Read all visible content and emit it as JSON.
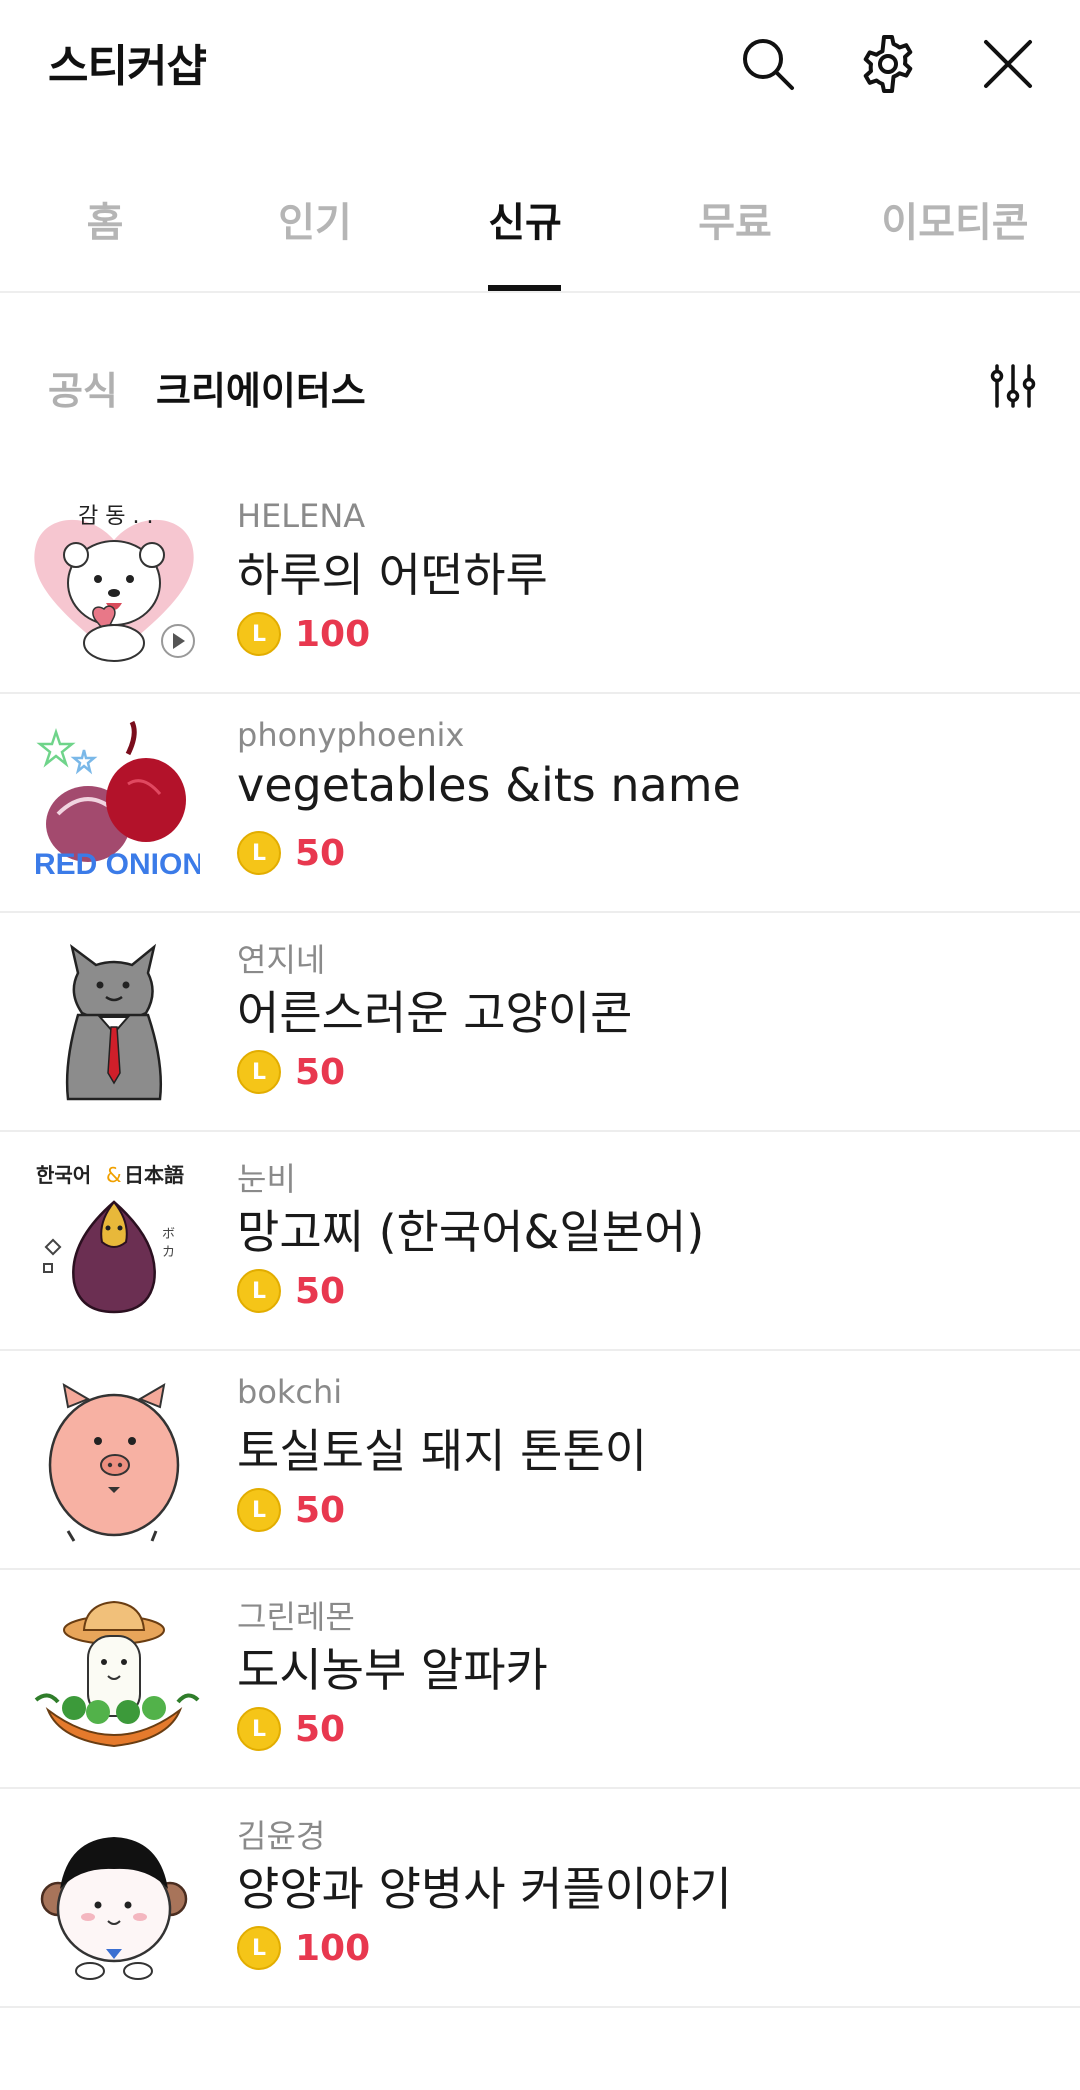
{
  "header": {
    "title": "스티커샵",
    "icons": [
      "search-icon",
      "gear-icon",
      "close-icon"
    ]
  },
  "tabs": [
    {
      "label": "홈"
    },
    {
      "label": "인기"
    },
    {
      "label": "신규"
    },
    {
      "label": "무료"
    },
    {
      "label": "이모티콘"
    }
  ],
  "active_tab": "신규",
  "subtabs": [
    {
      "label": "공식"
    },
    {
      "label": "크리에이터스"
    }
  ],
  "active_subtab": "크리에이터스",
  "filter_icon": "filter-sliders-icon",
  "colors": {
    "price": "#e8384f",
    "coin": "#f5c518",
    "inactive_tab": "#b5b5b5",
    "active_tab": "#111111"
  },
  "items": [
    {
      "creator": "HELENA",
      "name": "하루의 어떤하루",
      "price": "100",
      "coin_symbol": "L",
      "thumb": "bear-heart-sticker"
    },
    {
      "creator": "phonyphoenix",
      "name": "vegetables &its name",
      "price": "50",
      "coin_symbol": "L",
      "thumb": "red-onion-sticker"
    },
    {
      "creator": "연지네",
      "name": "어른스러운 고양이콘",
      "price": "50",
      "coin_symbol": "L",
      "thumb": "cat-tie-sticker"
    },
    {
      "creator": "눈비",
      "name": "망고찌 (한국어&일본어)",
      "price": "50",
      "coin_symbol": "L",
      "thumb": "purple-chestnut-sticker"
    },
    {
      "creator": "bokchi",
      "name": "토실토실 돼지 톤톤이",
      "price": "50",
      "coin_symbol": "L",
      "thumb": "pink-pig-sticker"
    },
    {
      "creator": "그린레몬",
      "name": "도시농부 알파카",
      "price": "50",
      "coin_symbol": "L",
      "thumb": "alpaca-farmer-sticker"
    },
    {
      "creator": "김윤경",
      "name": "양양과 양병사 커플이야기",
      "price": "100",
      "coin_symbol": "L",
      "thumb": "sheep-soldier-sticker"
    }
  ]
}
